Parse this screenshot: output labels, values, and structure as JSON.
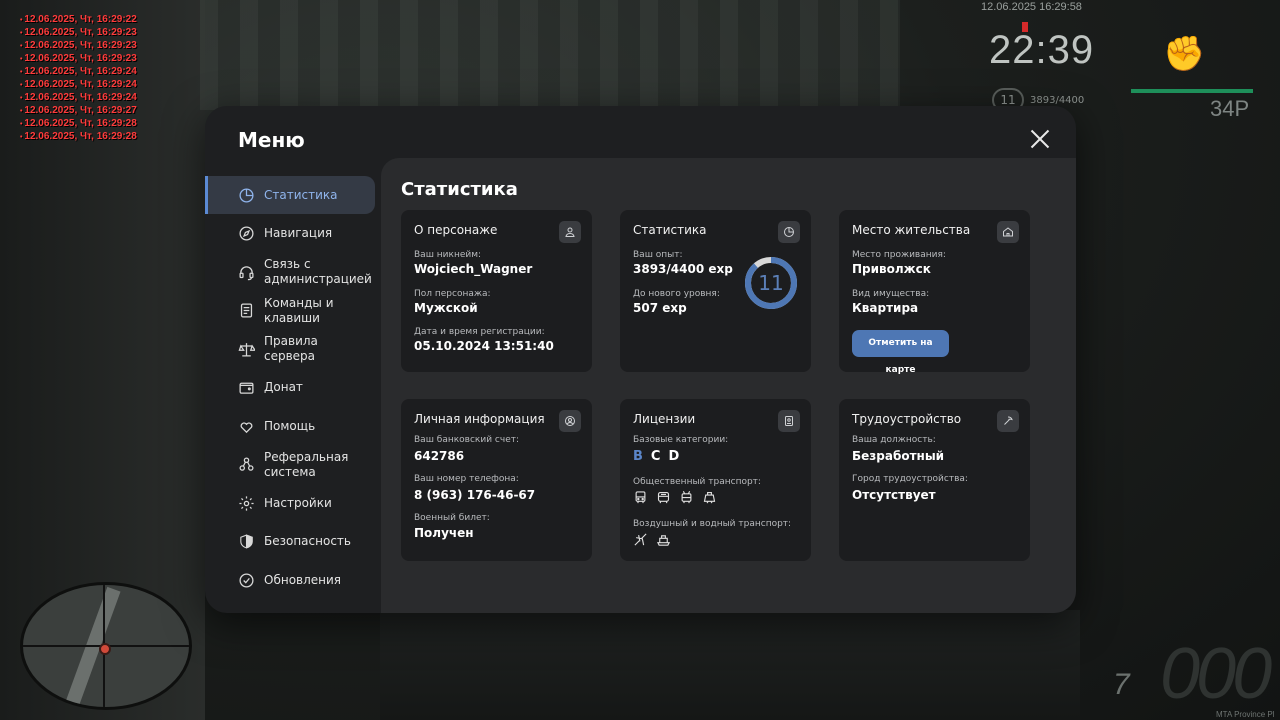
{
  "hud": {
    "chat_log": [
      "12.06.2025, Чт, 16:29:22",
      "12.06.2025, Чт, 16:29:23",
      "12.06.2025, Чт, 16:29:23",
      "12.06.2025, Чт, 16:29:23",
      "12.06.2025, Чт, 16:29:24",
      "12.06.2025, Чт, 16:29:24",
      "12.06.2025, Чт, 16:29:24",
      "12.06.2025, Чт, 16:29:27",
      "12.06.2025, Чт, 16:29:28",
      "12.06.2025, Чт, 16:29:28"
    ],
    "datetime": "12.06.2025 16:29:58",
    "clock": "22:39",
    "level": "11",
    "exp": "3893/4400",
    "money": "34Р",
    "speed": "000",
    "gear": "7",
    "watermark": "MTA Province Pl"
  },
  "menu": {
    "title": "Меню",
    "nav": [
      {
        "label": "Статистика",
        "icon": "chart-pie-icon",
        "active": true
      },
      {
        "label": "Навигация",
        "icon": "compass-icon",
        "active": false
      },
      {
        "label": "Связь с\nадминистрацией",
        "icon": "headset-icon",
        "active": false
      },
      {
        "label": "Команды и\nклавиши",
        "icon": "document-icon",
        "active": false
      },
      {
        "label": "Правила сервера",
        "icon": "scales-icon",
        "active": false
      },
      {
        "label": "Донат",
        "icon": "wallet-icon",
        "active": false
      },
      {
        "label": "Помощь",
        "icon": "heart-hand-icon",
        "active": false
      },
      {
        "label": "Реферальная\nсистема",
        "icon": "share-icon",
        "active": false
      },
      {
        "label": "Настройки",
        "icon": "gear-icon",
        "active": false
      },
      {
        "label": "Безопасность",
        "icon": "shield-icon",
        "active": false
      },
      {
        "label": "Обновления",
        "icon": "check-circle-icon",
        "active": false
      }
    ]
  },
  "content": {
    "title": "Статистика",
    "character": {
      "title": "О персонаже",
      "nickname_label": "Ваш никнейм:",
      "nickname": "Wojciech_Wagner",
      "gender_label": "Пол персонажа:",
      "gender": "Мужской",
      "reg_label": "Дата и время регистрации:",
      "reg_date": "05.10.2024 13:51:40"
    },
    "stats": {
      "title": "Статистика",
      "exp_label": "Ваш опыт:",
      "exp": "3893/4400 exp",
      "next_label": "До нового уровня:",
      "next": "507 exp",
      "level": "11",
      "progress": 0.885
    },
    "residence": {
      "title": "Место жительства",
      "place_label": "Место проживания:",
      "place": "Приволжск",
      "type_label": "Вид имущества:",
      "type": "Квартира",
      "button": "Отметить на карте"
    },
    "personal": {
      "title": "Личная информация",
      "bank_label": "Ваш банковский счет:",
      "bank": "642786",
      "phone_label": "Ваш номер телефона:",
      "phone": "8 (963) 176-46-67",
      "military_label": "Военный билет:",
      "military": "Получен"
    },
    "licenses": {
      "title": "Лицензии",
      "base_label": "Базовые категории:",
      "categories": [
        {
          "label": "B",
          "active": true
        },
        {
          "label": "C",
          "active": false
        },
        {
          "label": "D",
          "active": false
        }
      ],
      "public_label": "Общественный транспорт:",
      "air_label": "Воздушный и водный транспорт:"
    },
    "employment": {
      "title": "Трудоустройство",
      "position_label": "Ваша должность:",
      "position": "Безработный",
      "city_label": "Город трудоустройства:",
      "city": "Отсутствует"
    }
  },
  "colors": {
    "accent": "#5b86c9",
    "button": "#4e77b4",
    "active_nav_bg": "#343a45"
  }
}
